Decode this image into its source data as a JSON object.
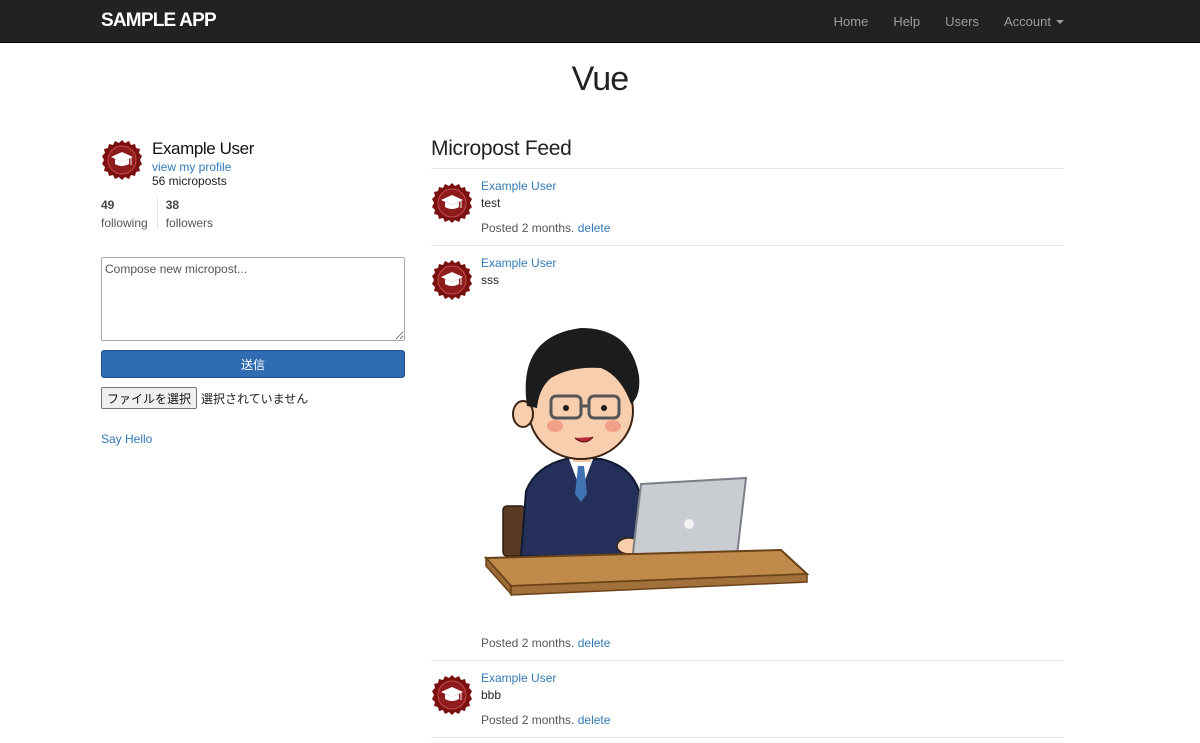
{
  "navbar": {
    "logo": "SAMPLE APP",
    "links": {
      "home": "Home",
      "help": "Help",
      "users": "Users",
      "account": "Account"
    }
  },
  "page": {
    "title": "Vue"
  },
  "sidebar": {
    "user_name": "Example User",
    "profile_link": "view my profile",
    "post_count": "56 microposts",
    "following_count": "49",
    "following_label": "following",
    "followers_count": "38",
    "followers_label": "followers",
    "compose_placeholder": "Compose new micropost...",
    "submit_label": "送信",
    "file_button": "ファイルを選択",
    "file_status": "選択されていません",
    "say_hello": "Say Hello"
  },
  "feed": {
    "title": "Micropost Feed",
    "posts": [
      {
        "user": "Example User",
        "content": "test",
        "posted": "Posted 2 months.",
        "delete": "delete"
      },
      {
        "user": "Example User",
        "content": "sss",
        "posted": "Posted 2 months.",
        "delete": "delete"
      },
      {
        "user": "Example User",
        "content": "bbb",
        "posted": "Posted 2 months.",
        "delete": "delete"
      }
    ]
  },
  "colors": {
    "navbar": "#222222",
    "link": "#337ab7",
    "primary_button": "#2f6cb1",
    "avatar": "#7a1a1a"
  },
  "icons": {
    "avatar": "graduation-cap-seal-icon",
    "caret": "caret-down-icon"
  }
}
